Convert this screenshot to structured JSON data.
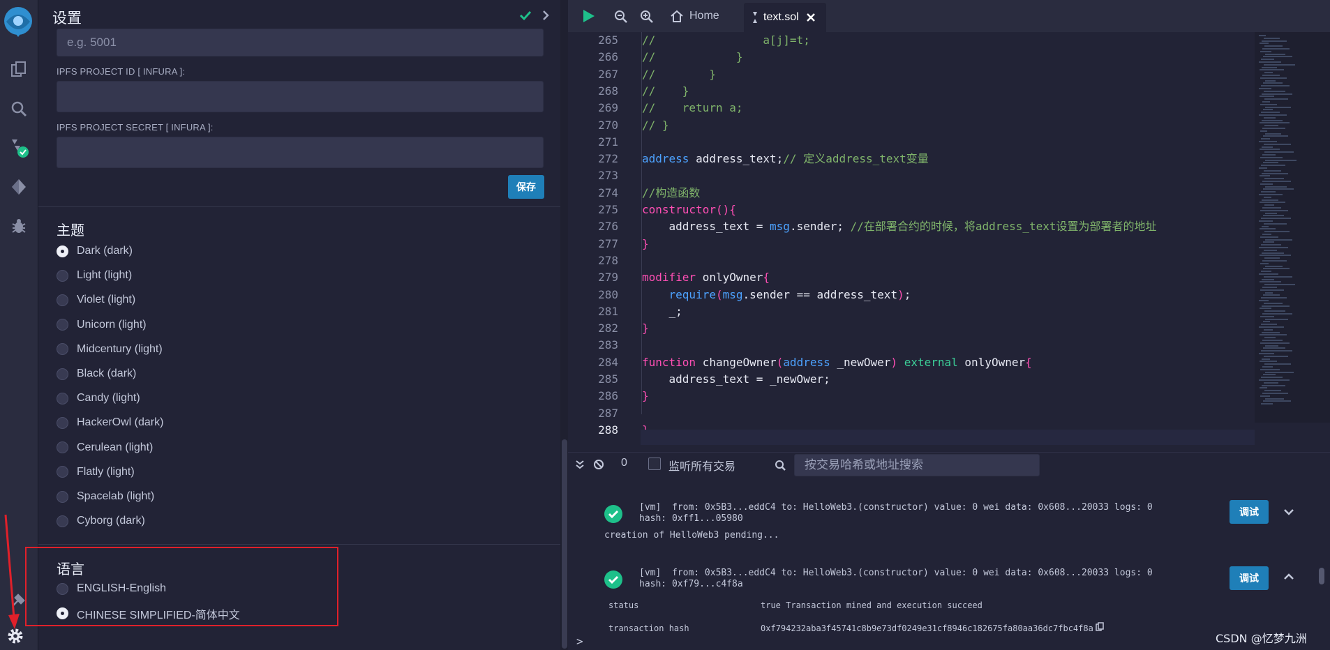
{
  "rail": {
    "icons": [
      "remix-logo-icon",
      "file-explorer-icon",
      "search-icon",
      "solidity-compiler-icon",
      "deploy-run-icon",
      "debugger-icon",
      "plugin-icon",
      "settings-gear-icon"
    ]
  },
  "settings": {
    "title": "设置",
    "port_placeholder": "e.g. 5001",
    "ipfs_project_id_label": "IPFS PROJECT ID [ INFURA ]:",
    "ipfs_project_secret_label": "IPFS PROJECT SECRET [ INFURA ]:",
    "save_label": "保存",
    "theme_title": "主题",
    "themes": [
      {
        "label": "Dark (dark)",
        "selected": true
      },
      {
        "label": "Light (light)",
        "selected": false
      },
      {
        "label": "Violet (light)",
        "selected": false
      },
      {
        "label": "Unicorn (light)",
        "selected": false
      },
      {
        "label": "Midcentury (light)",
        "selected": false
      },
      {
        "label": "Black (dark)",
        "selected": false
      },
      {
        "label": "Candy (light)",
        "selected": false
      },
      {
        "label": "HackerOwl (dark)",
        "selected": false
      },
      {
        "label": "Cerulean (light)",
        "selected": false
      },
      {
        "label": "Flatly (light)",
        "selected": false
      },
      {
        "label": "Spacelab (light)",
        "selected": false
      },
      {
        "label": "Cyborg (dark)",
        "selected": false
      }
    ],
    "language_title": "语言",
    "languages": [
      {
        "label": "ENGLISH-English",
        "selected": false
      },
      {
        "label": "CHINESE SIMPLIFIED-简体中文",
        "selected": true
      }
    ]
  },
  "editor": {
    "tab_home": "Home",
    "tab_file": "text.sol",
    "current_line": "288",
    "lines": [
      {
        "n": "265",
        "t": "//                a[j]=t;"
      },
      {
        "n": "266",
        "t": "//            }"
      },
      {
        "n": "267",
        "t": "//        }"
      },
      {
        "n": "268",
        "t": "//    }"
      },
      {
        "n": "269",
        "t": "//    return a;"
      },
      {
        "n": "270",
        "t": "// }"
      },
      {
        "n": "271",
        "t": ""
      },
      {
        "n": "272",
        "t": "address address_text;// 定义address_text变量"
      },
      {
        "n": "273",
        "t": ""
      },
      {
        "n": "274",
        "t": "//构造函数"
      },
      {
        "n": "275",
        "t": "constructor(){"
      },
      {
        "n": "276",
        "t": "    address_text = msg.sender; //在部署合约的时候，将address_text设置为部署者的地址"
      },
      {
        "n": "277",
        "t": "}"
      },
      {
        "n": "278",
        "t": ""
      },
      {
        "n": "279",
        "t": "modifier onlyOwner{"
      },
      {
        "n": "280",
        "t": "    require(msg.sender == address_text);"
      },
      {
        "n": "281",
        "t": "    _;"
      },
      {
        "n": "282",
        "t": "}"
      },
      {
        "n": "283",
        "t": ""
      },
      {
        "n": "284",
        "t": "function changeOwner(address _newOwer) external onlyOwner{"
      },
      {
        "n": "285",
        "t": "    address_text = _newOwer;"
      },
      {
        "n": "286",
        "t": "}"
      },
      {
        "n": "287",
        "t": ""
      },
      {
        "n": "288",
        "t": "}"
      }
    ]
  },
  "terminal": {
    "tx_count": "0",
    "listen_label": "监听所有交易",
    "search_placeholder": "按交易哈希或地址搜索",
    "debug_label": "调试",
    "tx1_line1": "[vm]  from: 0x5B3...eddC4 to: HelloWeb3.(constructor) value: 0 wei data: 0x608...20033 logs: 0",
    "tx1_line2": "hash: 0xff1...05980",
    "tx1_pending": "creation of HelloWeb3 pending...",
    "tx2_line1": "[vm]  from: 0x5B3...eddC4 to: HelloWeb3.(constructor) value: 0 wei data: 0x608...20033 logs: 0",
    "tx2_line2": "hash: 0xf79...c4f8a",
    "status_key": "status",
    "status_val": "true Transaction mined and execution succeed",
    "txhash_key": "transaction hash",
    "txhash_val": "0xf794232aba3f45741c8b9e73df0249e31cf8946c182675fa80aa36dc7fbc4f8a",
    "prompt": ">"
  },
  "watermark": "CSDN @忆梦九洲",
  "colors": {
    "accent": "#1f7fb8",
    "success": "#1ec08a",
    "highlight_box": "#e0202a"
  }
}
